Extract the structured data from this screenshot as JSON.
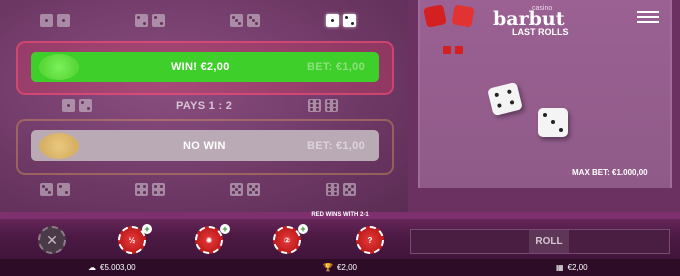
{
  "bets": {
    "top_win": {
      "result": "WIN! €2,00",
      "bet": "BET: €1,00"
    },
    "payout": "PAYS 1 : 2",
    "bottom_win": {
      "result": "NO WIN",
      "bet": "BET: €1,00"
    }
  },
  "brand": {
    "small": "casino",
    "name": "barbut",
    "subtitle": "LAST ROLLS"
  },
  "max_bet": "MAX BET: €1.000,00",
  "banner": "RED WINS WITH 2-1",
  "roll_label": "ROLL",
  "balance": "€5.003,00",
  "win_total": "€2,00",
  "bet_total": "€2,00",
  "colors": {
    "accent_green": "#3fcf2a",
    "chip_red": "#d32222",
    "panel": "#8f5a88"
  }
}
